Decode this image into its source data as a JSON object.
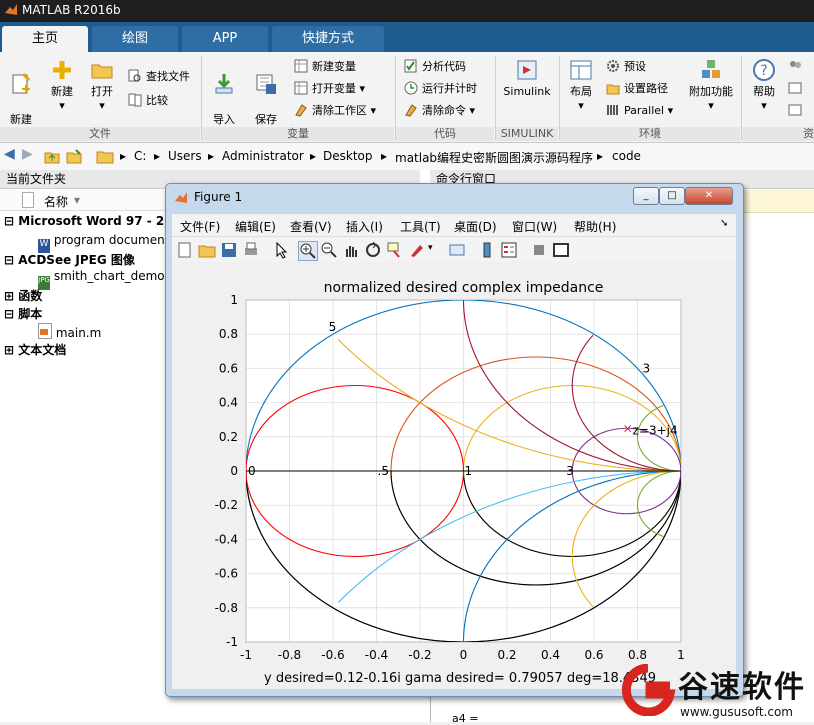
{
  "app": {
    "title": "MATLAB R2016b"
  },
  "tabs": [
    {
      "label": "主页",
      "active": true
    },
    {
      "label": "绘图"
    },
    {
      "label": "APP"
    },
    {
      "label": "快捷方式"
    }
  ],
  "ribbon": {
    "file": {
      "group": "文件",
      "new_script": "新建\n脚本",
      "new": "新建",
      "open": "打开",
      "find_files": "查找文件",
      "compare": "比较"
    },
    "variable": {
      "group": "变量",
      "import": "导入\n数据",
      "save_ws": "保存\n工作区",
      "new_var": "新建变量",
      "open_var": "打开变量",
      "clear_ws": "清除工作区"
    },
    "code": {
      "group": "代码",
      "analyze": "分析代码",
      "run_time": "运行并计时",
      "clear_cmd": "清除命令"
    },
    "simulink": {
      "group": "SIMULINK",
      "label": "Simulink"
    },
    "env": {
      "group": "环境",
      "layout": "布局",
      "prefs": "预设",
      "set_path": "设置路径",
      "parallel": "Parallel",
      "addons": "附加功能"
    },
    "resources": {
      "group": "资",
      "help": "帮助"
    }
  },
  "address": {
    "segments": [
      "C:",
      "Users",
      "Administrator",
      "Desktop",
      "matlab编程史密斯圆图演示源码程序",
      "code"
    ]
  },
  "left_panel": {
    "title": "当前文件夹",
    "column": "名称",
    "items": [
      {
        "label": "Microsoft Word 97 - 200",
        "group": true
      },
      {
        "label": "program documen",
        "group": false
      },
      {
        "label": "ACDSee JPEG 图像",
        "group": true
      },
      {
        "label": "smith_chart_demo.",
        "group": false
      },
      {
        "label": "函数",
        "group": true
      },
      {
        "label": "脚本",
        "group": true
      },
      {
        "label": "main.m",
        "group": false
      },
      {
        "label": "文本文档",
        "group": true
      }
    ]
  },
  "cmd_panel": {
    "title": "命令行窗口",
    "bottom_text": "a4 ="
  },
  "figure": {
    "title": "Figure 1",
    "menu": [
      "文件(F)",
      "编辑(E)",
      "查看(V)",
      "插入(I)",
      "工具(T)",
      "桌面(D)",
      "窗口(W)",
      "帮助(H)"
    ],
    "plot_title": "normalized desired complex impedance",
    "bottom_text": "y desired=0.12-0.16i   gama desired= 0.79057 deg=18.4349",
    "annotation": "z=3+j4",
    "labels": {
      "five_top": "5",
      "zero": "0",
      "half": ".5",
      "one": "1",
      "three": "3",
      "three_top": "3"
    },
    "x_ticks": [
      "-1",
      "-0.8",
      "-0.6",
      "-0.4",
      "-0.2",
      "0",
      "0.2",
      "0.4",
      "0.6",
      "0.8",
      "1"
    ],
    "y_ticks": [
      "1",
      "0.8",
      "0.6",
      "0.4",
      "0.2",
      "0",
      "-0.2",
      "-0.4",
      "-0.6",
      "-0.8",
      "-1"
    ]
  },
  "chart_data": {
    "type": "line",
    "title": "normalized desired complex impedance",
    "xlim": [
      -1,
      1
    ],
    "ylim": [
      -1,
      1
    ],
    "grid": true,
    "xlabel": "",
    "ylabel": "",
    "x_ticks": [
      -1,
      -0.8,
      -0.6,
      -0.4,
      -0.2,
      0,
      0.2,
      0.4,
      0.6,
      0.8,
      1
    ],
    "y_ticks": [
      -1,
      -0.8,
      -0.6,
      -0.4,
      -0.2,
      0,
      0.2,
      0.4,
      0.6,
      0.8,
      1
    ],
    "resistance_circles": [
      0,
      0.5,
      1,
      3
    ],
    "reactance_arcs": [
      0.5,
      1,
      2,
      5
    ],
    "marker": {
      "x": 0.75,
      "y": 0.25,
      "label": "z=3+j4"
    },
    "colors": {
      "r0": "#0072bd",
      "r05": "#d95319",
      "r1": "#edb120",
      "r3": "#7e2f8e",
      "x05": "#000000",
      "x1": "#a2142f",
      "x2": "#4dbeee",
      "x5": "#77ac30",
      "red": "#ff0000"
    }
  },
  "watermark": {
    "brand": "谷速软件",
    "url": "www.gususoft.com"
  }
}
